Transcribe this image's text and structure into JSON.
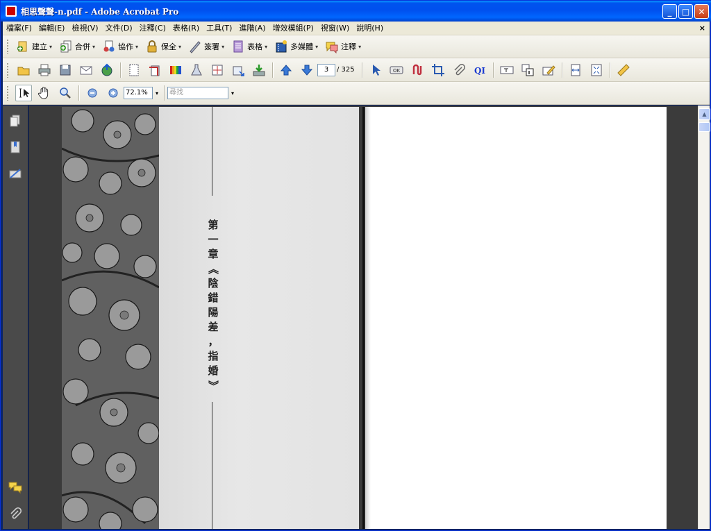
{
  "window": {
    "title": "相思聲聲-n.pdf - Adobe Acrobat Pro",
    "buttons": {
      "minimize": "_",
      "maximize": "□",
      "close": "✕"
    }
  },
  "menu": {
    "items": [
      "檔案(F)",
      "編輯(E)",
      "檢視(V)",
      "文件(D)",
      "注釋(C)",
      "表格(R)",
      "工具(T)",
      "進階(A)",
      "增效模組(P)",
      "視窗(W)",
      "說明(H)"
    ],
    "close_glyph": "×"
  },
  "toolbar_tasks": {
    "create": "建立",
    "combine": "合併",
    "collaborate": "協作",
    "secure": "保全",
    "sign": "簽署",
    "forms": "表格",
    "multimedia": "多媒體",
    "comment": "注釋",
    "dropdown_glyph": "▾"
  },
  "toolbar_nav": {
    "current_page": "3",
    "total_pages": "/ 325",
    "ok_label": "OK",
    "qi_label": "QI"
  },
  "toolbar_view": {
    "zoom": "72.1%",
    "find_placeholder": "尋找",
    "dropdown_glyph": "▾"
  },
  "document": {
    "chapter_text": [
      "第",
      "一",
      "章",
      "《",
      "陰",
      "錯",
      "陽",
      "差",
      "，",
      "指",
      "婚",
      "》"
    ]
  },
  "scroll": {
    "up_glyph": "▲"
  },
  "colors": {
    "titlebar": "#0054e3",
    "chrome": "#ece9d8",
    "doc_bg": "#3b3b3b",
    "nav_bg": "#4a4a4a"
  }
}
